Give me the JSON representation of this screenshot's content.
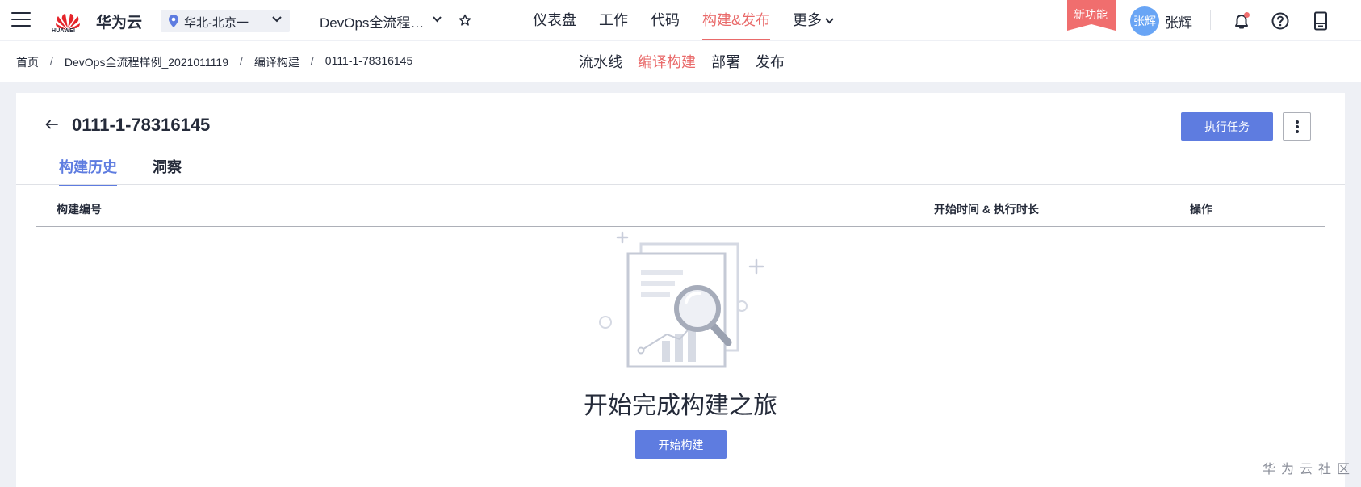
{
  "topbar": {
    "brand": "华为云",
    "logo_text": "HUAWEI",
    "region": "华北-北京一",
    "project": "DevOps全流程…",
    "nav": [
      {
        "label": "仪表盘"
      },
      {
        "label": "工作"
      },
      {
        "label": "代码"
      },
      {
        "label": "构建&发布"
      },
      {
        "label": "更多"
      }
    ],
    "active_nav": "构建&发布",
    "new_feature": "新功能",
    "avatar_text": "张辉",
    "username": "张辉"
  },
  "breadcrumb": [
    "首页",
    "DevOps全流程样例_2021011119",
    "编译构建",
    "0111-1-78316145"
  ],
  "subnav": [
    {
      "label": "流水线"
    },
    {
      "label": "编译构建"
    },
    {
      "label": "部署"
    },
    {
      "label": "发布"
    }
  ],
  "active_subnav": "编译构建",
  "page": {
    "title": "0111-1-78316145",
    "execute_button": "执行任务",
    "tabs": [
      {
        "label": "构建历史"
      },
      {
        "label": "洞察"
      }
    ],
    "active_tab": "构建历史",
    "columns": [
      "构建编号",
      "开始时间 & 执行时长",
      "操作"
    ],
    "empty_title": "开始完成构建之旅",
    "start_button": "开始构建"
  },
  "watermark": "华为云社区",
  "colors": {
    "primary": "#5e7ce0",
    "accent": "#e96a6a",
    "avatar": "#69a5f5",
    "text": "#252b3a"
  }
}
